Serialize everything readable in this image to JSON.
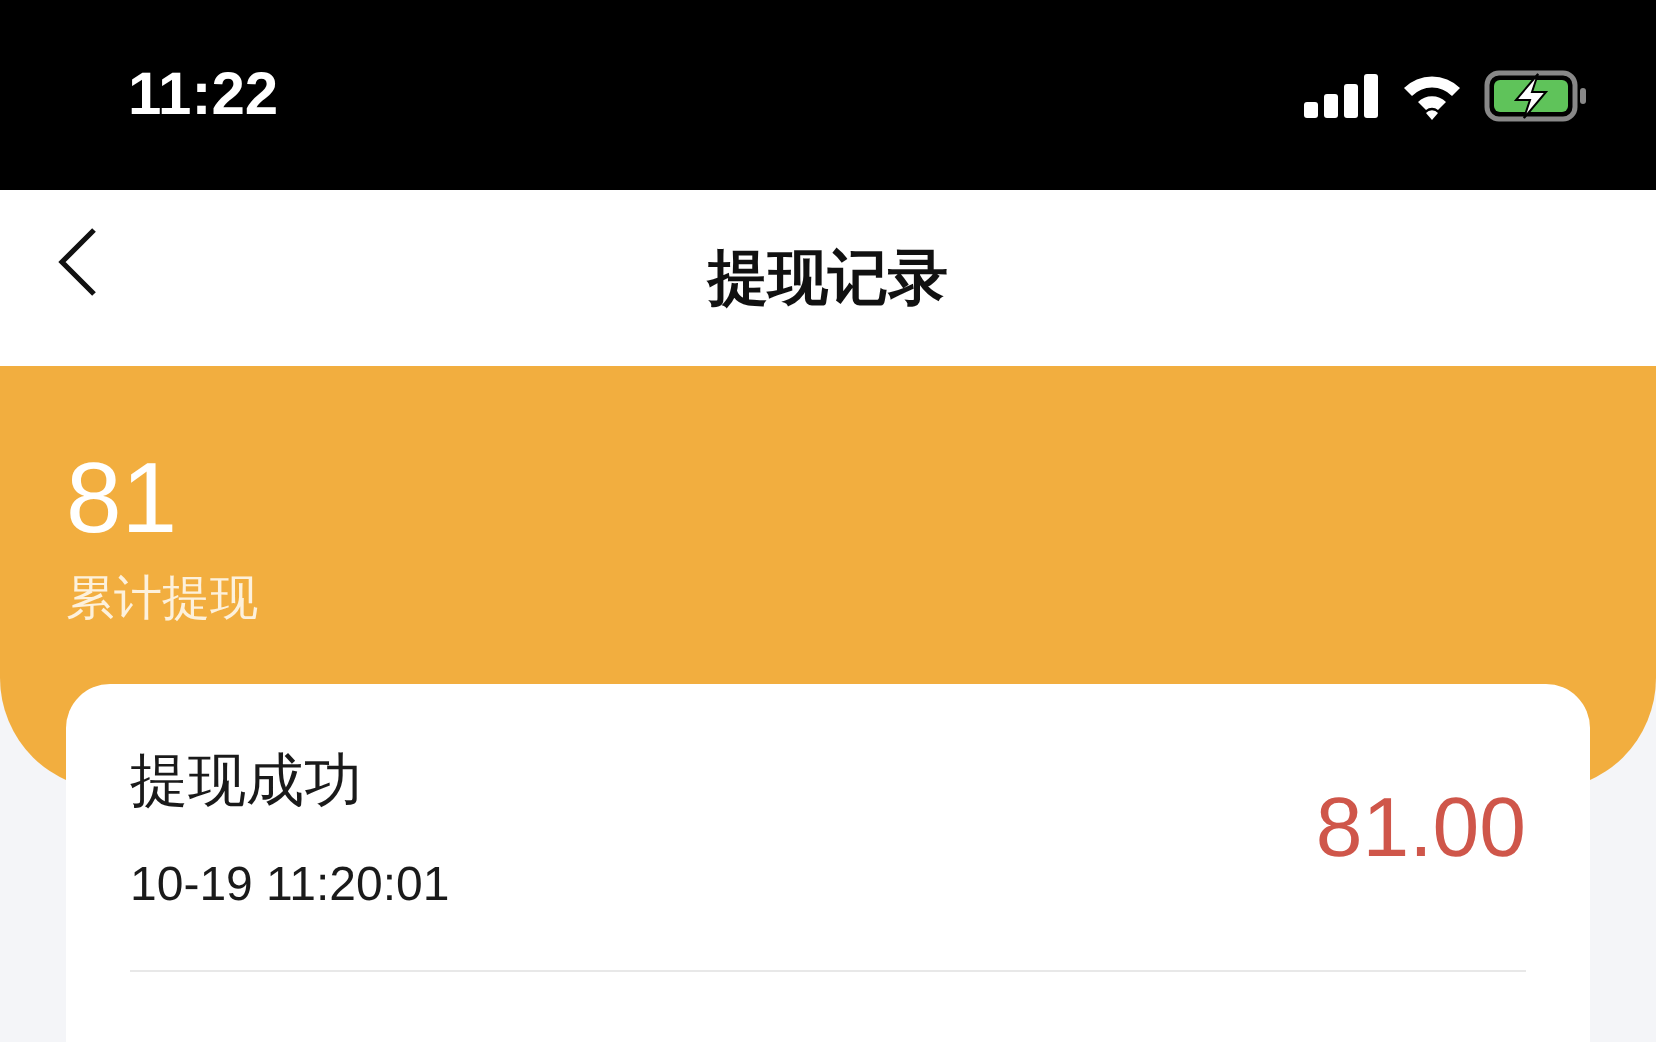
{
  "status_bar": {
    "time": "11:22"
  },
  "nav": {
    "title": "提现记录"
  },
  "summary": {
    "total": "81",
    "label": "累计提现"
  },
  "records": [
    {
      "title": "提现成功",
      "time": "10-19 11:20:01",
      "amount": "81.00"
    }
  ]
}
